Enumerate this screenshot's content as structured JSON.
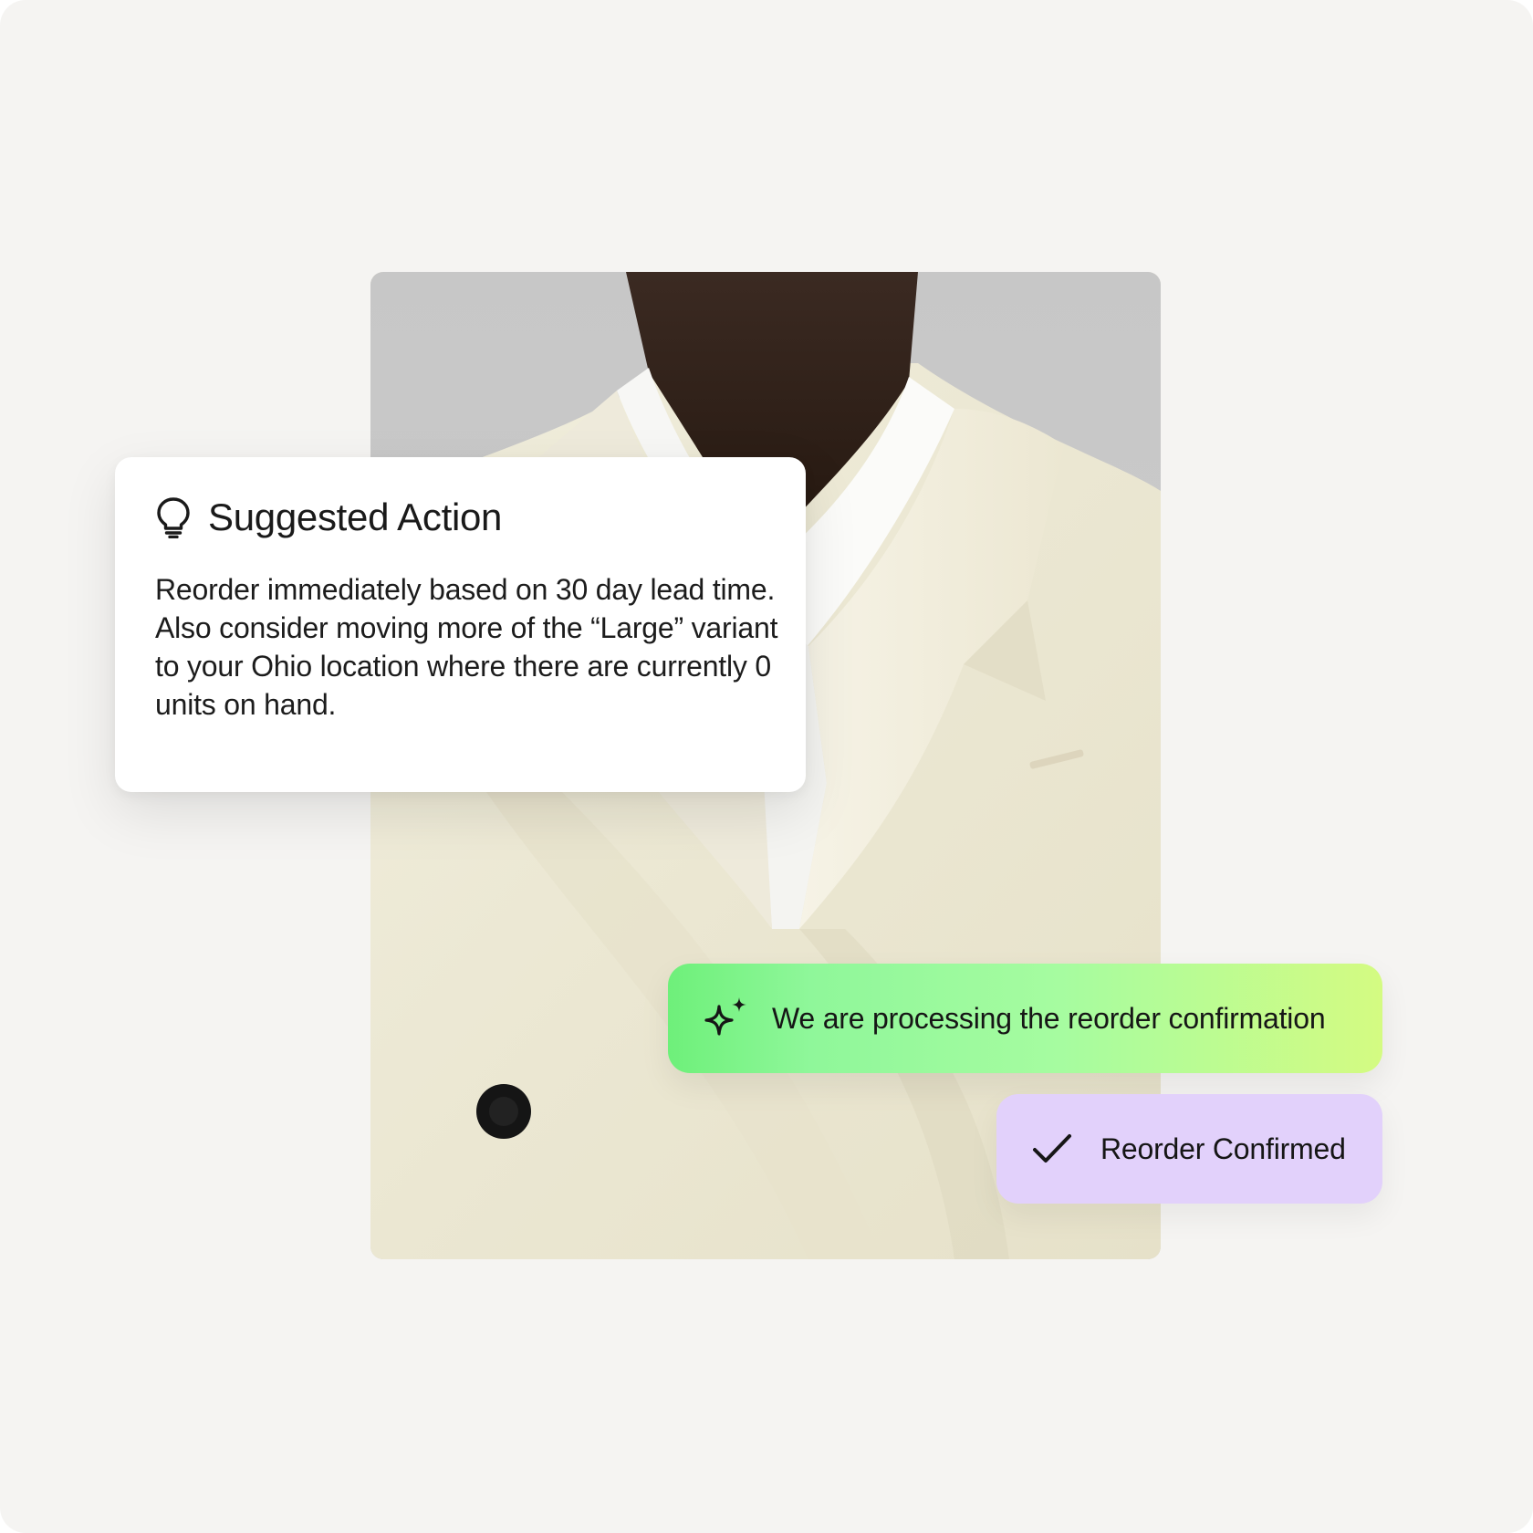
{
  "suggestion_card": {
    "icon": "lightbulb-icon",
    "title": "Suggested Action",
    "body": "Reorder immediately based on 30 day lead time. Also consider moving more of the “Large” variant to your Ohio location where there are currently 0 units on hand."
  },
  "processing_status": {
    "icon": "sparkle-icon",
    "text": "We are processing the reorder confirmation",
    "gradient_start": "#6ef07a",
    "gradient_end": "#d4fb82"
  },
  "confirmation_status": {
    "icon": "checkmark-icon",
    "text": "Reorder Confirmed",
    "background": "#e2d1fb"
  },
  "colors": {
    "page_background": "#f5f4f2",
    "card_background": "#ffffff",
    "text": "#1a1a1a"
  }
}
